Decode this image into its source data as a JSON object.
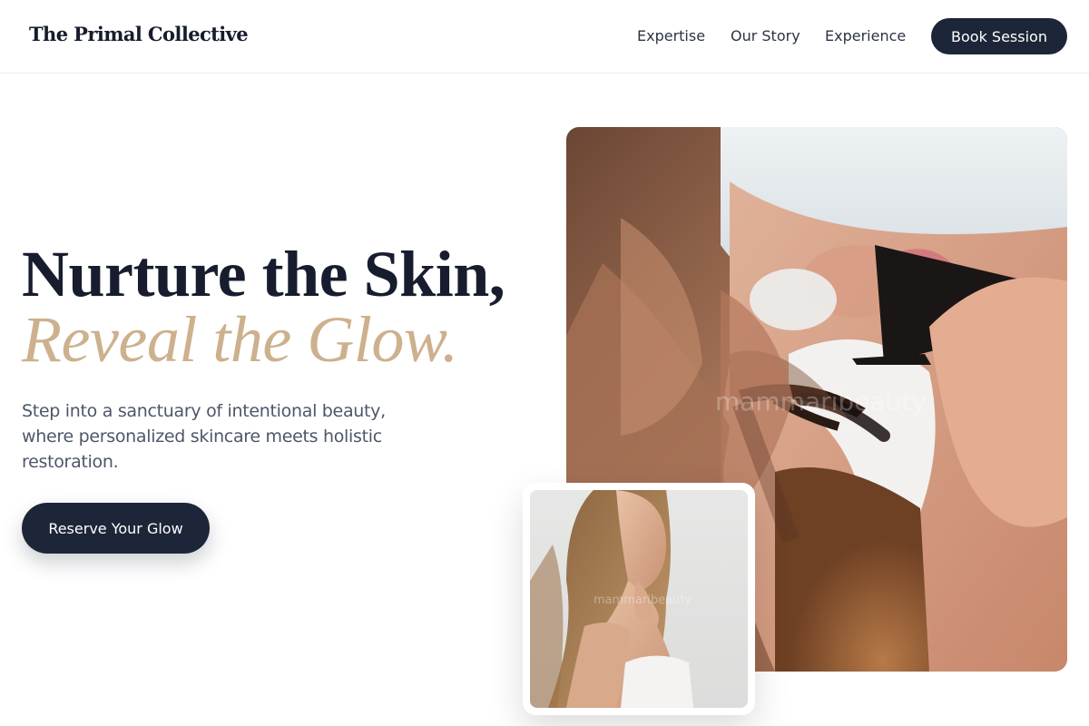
{
  "header": {
    "logo": "The Primal Collective",
    "nav": [
      "Expertise",
      "Our Story",
      "Experience"
    ],
    "cta": "Book Session"
  },
  "hero": {
    "headline_line1": "Nurture the Skin,",
    "headline_line2": "Reveal the Glow.",
    "subtext": "Step into a sanctuary of intentional beauty, where personalized skincare meets holistic restoration.",
    "cta": "Reserve Your Glow"
  },
  "images": {
    "main": {
      "watermark": "mammaribeauty"
    },
    "inset": {
      "watermark": "mammaribeauty"
    }
  },
  "colors": {
    "navy": "#1d2638",
    "gold": "#cdb08d",
    "text_muted": "#4d566a"
  }
}
